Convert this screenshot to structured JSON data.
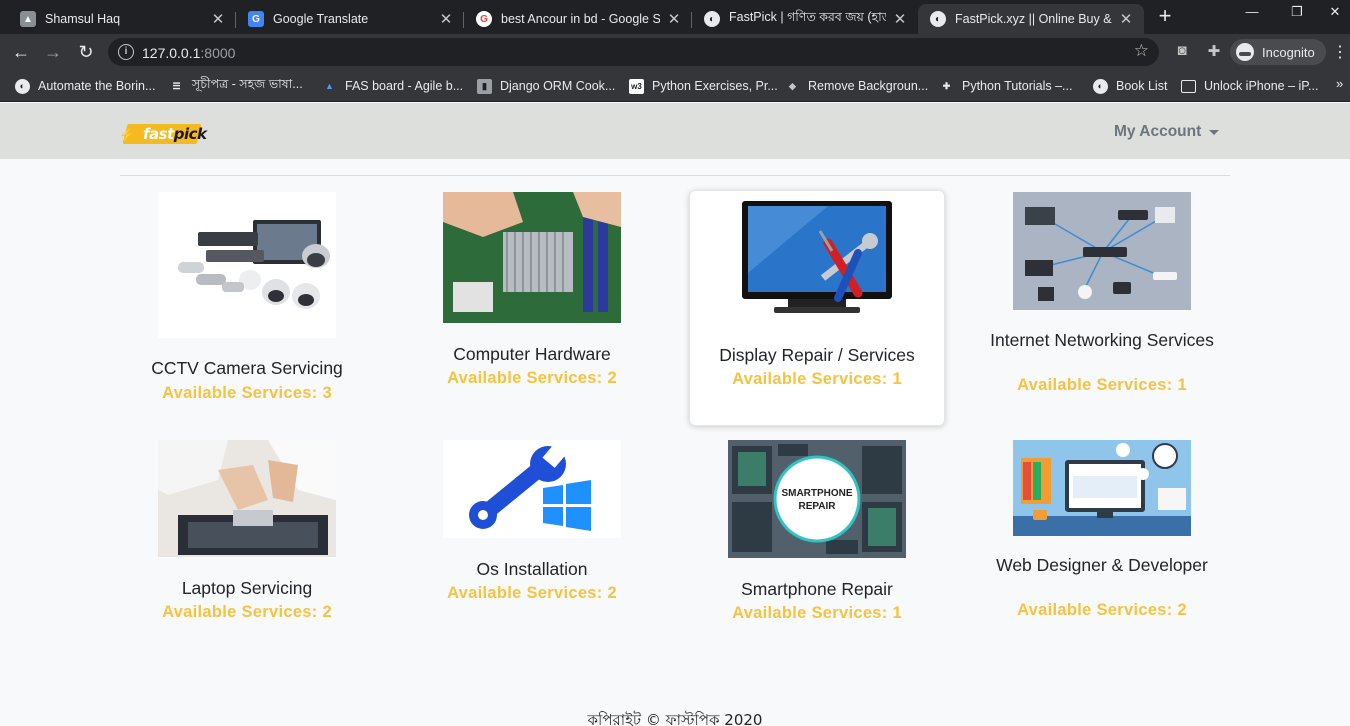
{
  "browser": {
    "tabs": [
      {
        "title": "Shamsul Haq",
        "favicon": "profile-photo-icon"
      },
      {
        "title": "Google Translate",
        "favicon": "google-translate-icon"
      },
      {
        "title": "best Ancour in bd - Google Se",
        "favicon": "google-icon"
      },
      {
        "title": "FastPick | গণিত করব জয় (হার্ডক",
        "favicon": "globe-icon"
      },
      {
        "title": "FastPick.xyz || Online Buy & Re",
        "favicon": "globe-icon",
        "active": true
      }
    ],
    "new_tab": "+",
    "address": {
      "host": "127.0.0.1",
      "port": ":8000"
    },
    "profile_label": "Incognito",
    "bookmarks": [
      {
        "label": "Automate the Borin...",
        "icon": "globe-icon"
      },
      {
        "label": "সূচীপত্র - সহজ ভাষা...",
        "icon": "list-icon"
      },
      {
        "label": "FAS board - Agile b...",
        "icon": "jira-icon"
      },
      {
        "label": "Django ORM Cook...",
        "icon": "book-icon"
      },
      {
        "label": "Python Exercises, Pr...",
        "icon": "w3-icon"
      },
      {
        "label": "Remove Backgroun...",
        "icon": "layers-icon"
      },
      {
        "label": "Python Tutorials –...",
        "icon": "python-icon"
      },
      {
        "label": "Book List",
        "icon": "globe-icon"
      },
      {
        "label": "Unlock iPhone – iP...",
        "icon": "unlock-icon"
      }
    ]
  },
  "site": {
    "logo": {
      "prefix": "fast",
      "suffix": "pick"
    },
    "account_menu": "My Account",
    "categories": [
      {
        "name": "CCTV Camera Servicing",
        "available": "Available Services: 3",
        "image": "cctv-cameras"
      },
      {
        "name": "Computer Hardware",
        "available": "Available Services: 2",
        "image": "motherboard"
      },
      {
        "name": "Display Repair / Services",
        "available": "Available Services: 1",
        "image": "monitor-tools"
      },
      {
        "name": "Internet Networking Services",
        "available": "Available Services: 1",
        "image": "network-devices"
      },
      {
        "name": "Laptop Servicing",
        "available": "Available Services: 2",
        "image": "laptop-repair"
      },
      {
        "name": "Os Installation",
        "available": "Available Services: 2",
        "image": "wrench-windows"
      },
      {
        "name": "Smartphone Repair",
        "available": "Available Services: 1",
        "image": "smartphone-repair"
      },
      {
        "name": "Web Designer & Developer",
        "available": "Available Services: 2",
        "image": "freelance-work"
      }
    ],
    "footer": "কপিরাইট © ফাস্টপিক 2020"
  },
  "colors": {
    "accent": "#f5c342",
    "navbar_bg": "#dcdfdc",
    "page_bg": "#f8f9fa",
    "chrome_dark": "#202124"
  }
}
